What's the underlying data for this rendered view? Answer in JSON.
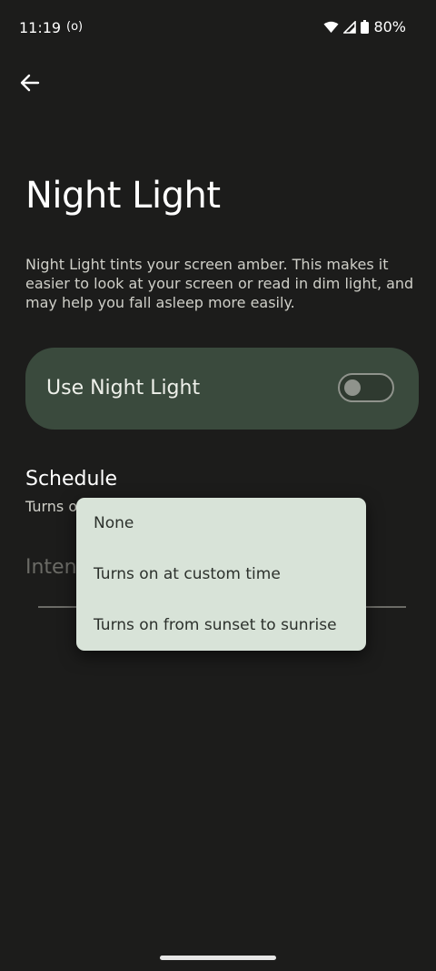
{
  "status_bar": {
    "time": "11:19",
    "cast_icon": "(o)",
    "battery": "80%"
  },
  "header": {
    "back_icon": "arrow-left-icon",
    "title": "Night Light"
  },
  "description": "Night Light tints your screen amber. This makes it easier to look at your screen or read in dim light, and may help you fall asleep more easily.",
  "use_night_light": {
    "label": "Use Night Light",
    "enabled": false,
    "card_color": "#3a4a3d"
  },
  "schedule": {
    "title": "Schedule",
    "subtitle_visible": "Turns o"
  },
  "intensity": {
    "label_visible": "Intens"
  },
  "schedule_menu": {
    "options": [
      {
        "label": "None"
      },
      {
        "label": "Turns on at custom time"
      },
      {
        "label": "Turns on from sunset to sunrise"
      }
    ],
    "background_color": "#d8e3d8"
  }
}
